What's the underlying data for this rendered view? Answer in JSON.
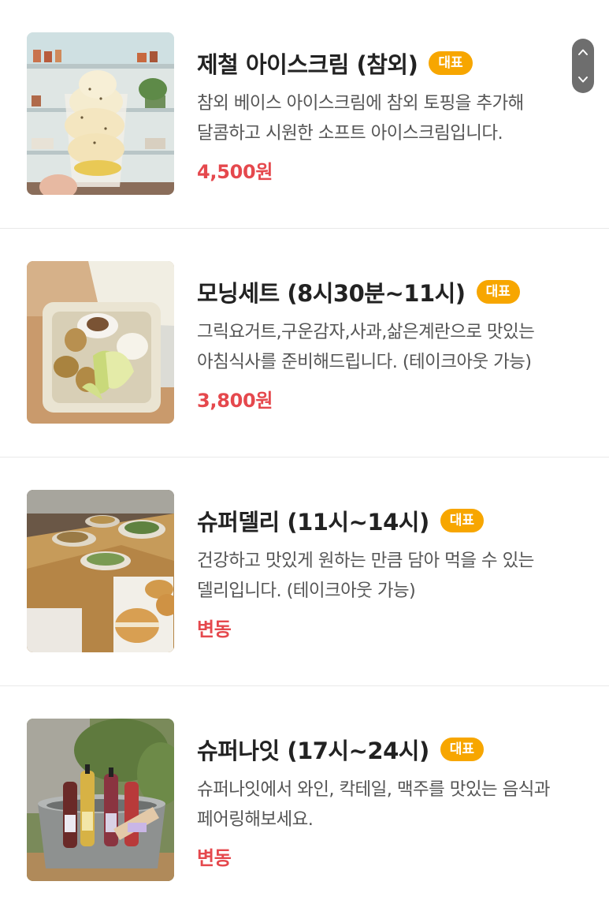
{
  "menu": {
    "items": [
      {
        "name": "제철 아이스크림 (참외)",
        "badge": "대표",
        "description": "참외 베이스 아이스크림에 참외 토핑을 추가해 달콤하고 시원한 소프트 아이스크림입니다.",
        "price": "4,500원"
      },
      {
        "name": "모닝세트 (8시30분~11시)",
        "badge": "대표",
        "description": "그릭요거트,구운감자,사과,삶은계란으로 맛있는 아침식사를 준비해드립니다. (테이크아웃 가능)",
        "price": "3,800원"
      },
      {
        "name": "슈퍼델리 (11시~14시)",
        "badge": "대표",
        "description": "건강하고 맛있게 원하는 만큼 담아 먹을 수 있는 델리입니다. (테이크아웃 가능)",
        "price": "변동"
      },
      {
        "name": "슈퍼나잇 (17시~24시)",
        "badge": "대표",
        "description": "슈퍼나잇에서 와인, 칵테일, 맥주를 맛있는 음식과 페어링해보세요.",
        "price": "변동"
      }
    ]
  },
  "scroll": {
    "up_icon": "chevron-up-icon",
    "down_icon": "chevron-down-icon"
  },
  "colors": {
    "badge": "#f7a600",
    "price": "#e5484d",
    "title": "#222222",
    "description": "#555555",
    "divider": "#e9e9e9",
    "scroll_control": "#6e6e6e"
  }
}
